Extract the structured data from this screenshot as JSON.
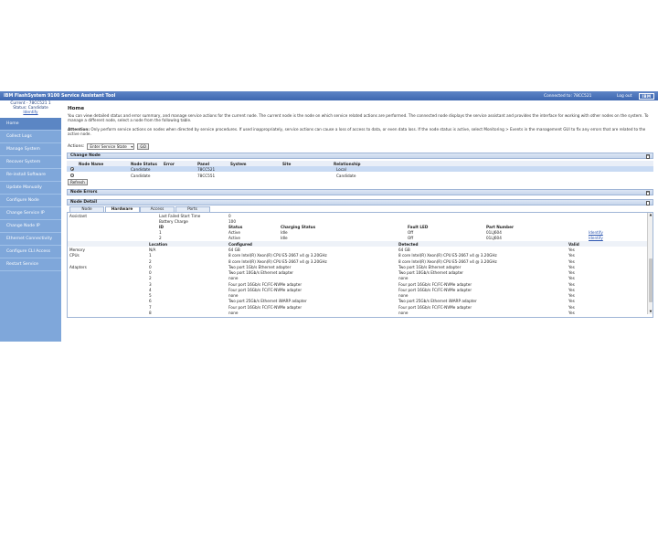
{
  "header": {
    "title": "IBM FlashSystem 9100 Service Assistant Tool",
    "connected": "Connected to: 78CC521",
    "logout": "Log out",
    "logo": "IBM"
  },
  "sidebar": {
    "current_line": "Current - 78CC521 1",
    "status_line": "Status: Candidate",
    "identify": "Identify",
    "items": [
      {
        "label": "Home"
      },
      {
        "label": "Collect Logs"
      },
      {
        "label": "Manage System"
      },
      {
        "label": "Recover System"
      },
      {
        "label": "Re-install Software"
      },
      {
        "label": "Update Manually"
      },
      {
        "label": "Configure Node"
      },
      {
        "label": "Change Service IP"
      },
      {
        "label": "Change Node IP"
      },
      {
        "label": "Ethernet Connectivity"
      },
      {
        "label": "Configure CLI Access"
      },
      {
        "label": "Restart Service"
      }
    ]
  },
  "main": {
    "title": "Home",
    "intro": "You can view detailed status and error summary, and manage service actions for the current node. The current node is the node on which service related actions are performed. The connected node displays the service assistant and provides the interface for working with other nodes on the system. To manage a different node, select a node from the following table.",
    "attention_label": "Attention:",
    "attention_text": " Only perform service actions on nodes when directed by service procedures. If used inappropriately, service actions can cause a loss of access to data, or even data loss. If the node status is active, select Monitoring > Events in the management GUI to fix any errors that are related to the active node.",
    "actions_label": "Actions:",
    "actions_select": "Enter Service State",
    "go_button": "GO"
  },
  "change_node": {
    "title": "Change Node",
    "columns": [
      "Node Name",
      "Node Status",
      "Error",
      "Panel",
      "System",
      "Site",
      "Relationship"
    ],
    "rows": [
      {
        "name": "",
        "status": "Candidate",
        "error": "",
        "panel": "78CC521",
        "system": "",
        "site": "",
        "relationship": "Local"
      },
      {
        "name": "",
        "status": "Candidate",
        "error": "",
        "panel": "78CC551",
        "system": "",
        "site": "",
        "relationship": "Candidate"
      }
    ],
    "refresh": "Refresh"
  },
  "node_errors": {
    "title": "Node Errors"
  },
  "node_detail": {
    "title": "Node Detail",
    "tabs": [
      "Node",
      "Hardware",
      "Access",
      "Ports"
    ],
    "partial": {
      "l1_label": "Last Failed Start Time",
      "l1_value": "0",
      "l2_label": "Battery Charge",
      "l2_value": "100",
      "left_label": "Assistant"
    },
    "battery_cols": [
      "ID",
      "Status",
      "Charging Status",
      "Fault LED",
      "Part Number"
    ],
    "battery_rows": [
      {
        "id": "1",
        "status": "Active",
        "charging": "Idle",
        "led": "Off",
        "part": "01LJ604",
        "action": "Identify"
      },
      {
        "id": "2",
        "status": "Active",
        "charging": "Idle",
        "led": "Off",
        "part": "01LJ604",
        "action": "Identify"
      }
    ],
    "hw_cols": [
      "Location",
      "Configured",
      "Detected",
      "Valid"
    ],
    "hw_rows": [
      {
        "group": "Memory",
        "loc": "N/A",
        "conf": "64 GB",
        "det": "64 GB",
        "valid": "Yes"
      },
      {
        "group": "CPUs",
        "loc": "1",
        "conf": "8 core Intel(R) Xeon(R) CPU E5-2667 v4 @ 3.20GHz",
        "det": "8 core Intel(R) Xeon(R) CPU E5-2667 v4 @ 3.20GHz",
        "valid": "Yes"
      },
      {
        "group": "",
        "loc": "2",
        "conf": "8 core Intel(R) Xeon(R) CPU E5-2667 v4 @ 3.20GHz",
        "det": "8 core Intel(R) Xeon(R) CPU E5-2667 v4 @ 3.20GHz",
        "valid": "Yes"
      },
      {
        "group": "Adapters",
        "loc": "0",
        "conf": "Two port 1Gb/s Ethernet adapter",
        "det": "Two port 1Gb/s Ethernet adapter",
        "valid": "Yes"
      },
      {
        "group": "",
        "loc": "0",
        "conf": "Two port 10Gb/s Ethernet adapter",
        "det": "Two port 10Gb/s Ethernet adapter",
        "valid": "Yes"
      },
      {
        "group": "",
        "loc": "2",
        "conf": "none",
        "det": "none",
        "valid": "Yes"
      },
      {
        "group": "",
        "loc": "3",
        "conf": "Four port 16Gb/s FC/FC-NVMe adapter",
        "det": "Four port 16Gb/s FC/FC-NVMe adapter",
        "valid": "Yes"
      },
      {
        "group": "",
        "loc": "4",
        "conf": "Four port 16Gb/s FC/FC-NVMe adapter",
        "det": "Four port 16Gb/s FC/FC-NVMe adapter",
        "valid": "Yes"
      },
      {
        "group": "",
        "loc": "5",
        "conf": "none",
        "det": "none",
        "valid": "Yes"
      },
      {
        "group": "",
        "loc": "6",
        "conf": "Two port 25Gb/s Ethernet iWARP adapter",
        "det": "Two port 25Gb/s Ethernet iWARP adapter",
        "valid": "Yes"
      },
      {
        "group": "",
        "loc": "7",
        "conf": "Four port 16Gb/s FC/FC-NVMe adapter",
        "det": "Four port 16Gb/s FC/FC-NVMe adapter",
        "valid": "Yes"
      },
      {
        "group": "",
        "loc": "8",
        "conf": "none",
        "det": "none",
        "valid": "Yes"
      }
    ]
  },
  "colors": {
    "header": "#3d67b0",
    "sidebar": "#7fa7da",
    "selected_row": "#c8daf3"
  }
}
